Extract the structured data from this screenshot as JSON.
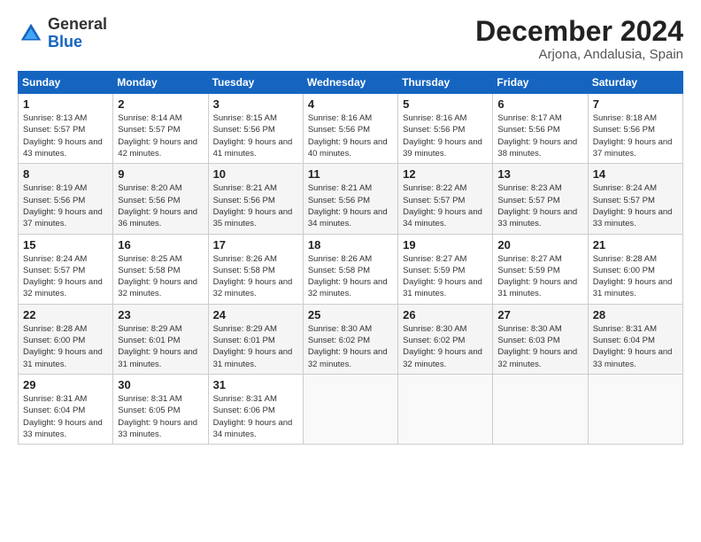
{
  "logo": {
    "general": "General",
    "blue": "Blue"
  },
  "header": {
    "month": "December 2024",
    "location": "Arjona, Andalusia, Spain"
  },
  "weekdays": [
    "Sunday",
    "Monday",
    "Tuesday",
    "Wednesday",
    "Thursday",
    "Friday",
    "Saturday"
  ],
  "weeks": [
    [
      {
        "day": "1",
        "sunrise": "8:13 AM",
        "sunset": "5:57 PM",
        "daylight": "9 hours and 43 minutes."
      },
      {
        "day": "2",
        "sunrise": "8:14 AM",
        "sunset": "5:57 PM",
        "daylight": "9 hours and 42 minutes."
      },
      {
        "day": "3",
        "sunrise": "8:15 AM",
        "sunset": "5:56 PM",
        "daylight": "9 hours and 41 minutes."
      },
      {
        "day": "4",
        "sunrise": "8:16 AM",
        "sunset": "5:56 PM",
        "daylight": "9 hours and 40 minutes."
      },
      {
        "day": "5",
        "sunrise": "8:16 AM",
        "sunset": "5:56 PM",
        "daylight": "9 hours and 39 minutes."
      },
      {
        "day": "6",
        "sunrise": "8:17 AM",
        "sunset": "5:56 PM",
        "daylight": "9 hours and 38 minutes."
      },
      {
        "day": "7",
        "sunrise": "8:18 AM",
        "sunset": "5:56 PM",
        "daylight": "9 hours and 37 minutes."
      }
    ],
    [
      {
        "day": "8",
        "sunrise": "8:19 AM",
        "sunset": "5:56 PM",
        "daylight": "9 hours and 37 minutes."
      },
      {
        "day": "9",
        "sunrise": "8:20 AM",
        "sunset": "5:56 PM",
        "daylight": "9 hours and 36 minutes."
      },
      {
        "day": "10",
        "sunrise": "8:21 AM",
        "sunset": "5:56 PM",
        "daylight": "9 hours and 35 minutes."
      },
      {
        "day": "11",
        "sunrise": "8:21 AM",
        "sunset": "5:56 PM",
        "daylight": "9 hours and 34 minutes."
      },
      {
        "day": "12",
        "sunrise": "8:22 AM",
        "sunset": "5:57 PM",
        "daylight": "9 hours and 34 minutes."
      },
      {
        "day": "13",
        "sunrise": "8:23 AM",
        "sunset": "5:57 PM",
        "daylight": "9 hours and 33 minutes."
      },
      {
        "day": "14",
        "sunrise": "8:24 AM",
        "sunset": "5:57 PM",
        "daylight": "9 hours and 33 minutes."
      }
    ],
    [
      {
        "day": "15",
        "sunrise": "8:24 AM",
        "sunset": "5:57 PM",
        "daylight": "9 hours and 32 minutes."
      },
      {
        "day": "16",
        "sunrise": "8:25 AM",
        "sunset": "5:58 PM",
        "daylight": "9 hours and 32 minutes."
      },
      {
        "day": "17",
        "sunrise": "8:26 AM",
        "sunset": "5:58 PM",
        "daylight": "9 hours and 32 minutes."
      },
      {
        "day": "18",
        "sunrise": "8:26 AM",
        "sunset": "5:58 PM",
        "daylight": "9 hours and 32 minutes."
      },
      {
        "day": "19",
        "sunrise": "8:27 AM",
        "sunset": "5:59 PM",
        "daylight": "9 hours and 31 minutes."
      },
      {
        "day": "20",
        "sunrise": "8:27 AM",
        "sunset": "5:59 PM",
        "daylight": "9 hours and 31 minutes."
      },
      {
        "day": "21",
        "sunrise": "8:28 AM",
        "sunset": "6:00 PM",
        "daylight": "9 hours and 31 minutes."
      }
    ],
    [
      {
        "day": "22",
        "sunrise": "8:28 AM",
        "sunset": "6:00 PM",
        "daylight": "9 hours and 31 minutes."
      },
      {
        "day": "23",
        "sunrise": "8:29 AM",
        "sunset": "6:01 PM",
        "daylight": "9 hours and 31 minutes."
      },
      {
        "day": "24",
        "sunrise": "8:29 AM",
        "sunset": "6:01 PM",
        "daylight": "9 hours and 31 minutes."
      },
      {
        "day": "25",
        "sunrise": "8:30 AM",
        "sunset": "6:02 PM",
        "daylight": "9 hours and 32 minutes."
      },
      {
        "day": "26",
        "sunrise": "8:30 AM",
        "sunset": "6:02 PM",
        "daylight": "9 hours and 32 minutes."
      },
      {
        "day": "27",
        "sunrise": "8:30 AM",
        "sunset": "6:03 PM",
        "daylight": "9 hours and 32 minutes."
      },
      {
        "day": "28",
        "sunrise": "8:31 AM",
        "sunset": "6:04 PM",
        "daylight": "9 hours and 33 minutes."
      }
    ],
    [
      {
        "day": "29",
        "sunrise": "8:31 AM",
        "sunset": "6:04 PM",
        "daylight": "9 hours and 33 minutes."
      },
      {
        "day": "30",
        "sunrise": "8:31 AM",
        "sunset": "6:05 PM",
        "daylight": "9 hours and 33 minutes."
      },
      {
        "day": "31",
        "sunrise": "8:31 AM",
        "sunset": "6:06 PM",
        "daylight": "9 hours and 34 minutes."
      },
      null,
      null,
      null,
      null
    ]
  ]
}
